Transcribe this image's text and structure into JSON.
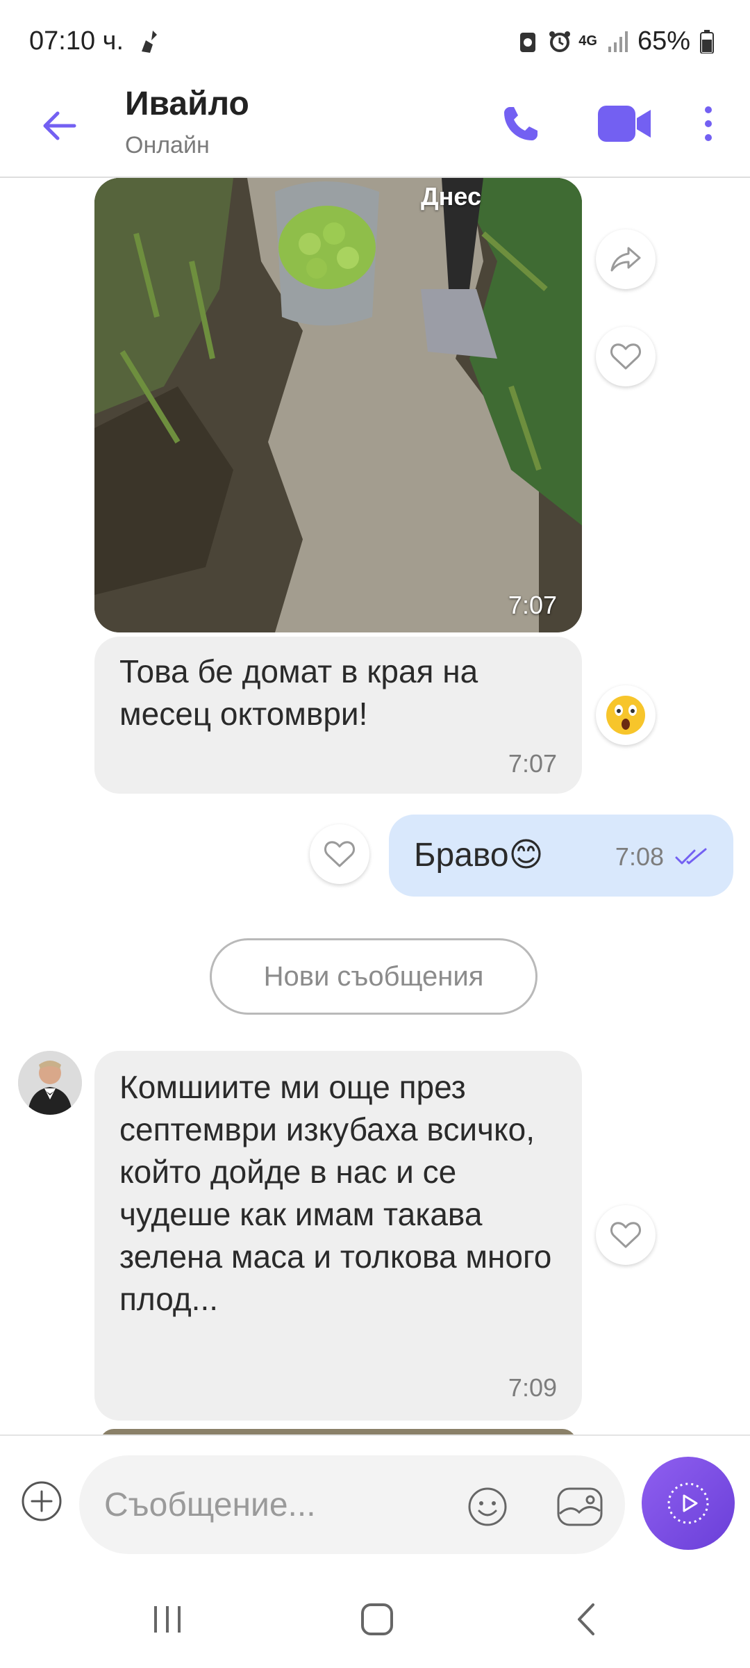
{
  "status_bar": {
    "time": "07:10 ч.",
    "battery": "65%",
    "network": "4G"
  },
  "header": {
    "contact_name": "Ивайло",
    "contact_status": "Онлайн"
  },
  "chat": {
    "day_label": "Днес",
    "photo_time": "7:07",
    "messages": [
      {
        "text": "Това бе домат в края на месец октомври!",
        "time": "7:07",
        "reaction": "astonished-face"
      },
      {
        "text": "Браво😊",
        "time": "7:08",
        "status": "read"
      },
      {
        "text": "Комшиите ми още през септември  изкубаха всичко, който дойде в нас и се чудеше как имам такава зелена маса и толкова много плод...",
        "time": "7:09"
      }
    ],
    "new_messages_label": "Нови съобщения"
  },
  "composer": {
    "placeholder": "Съобщение..."
  },
  "colors": {
    "accent": "#7360f2",
    "incoming_bubble": "#efefef",
    "outgoing_bubble": "#d9e8fc"
  }
}
